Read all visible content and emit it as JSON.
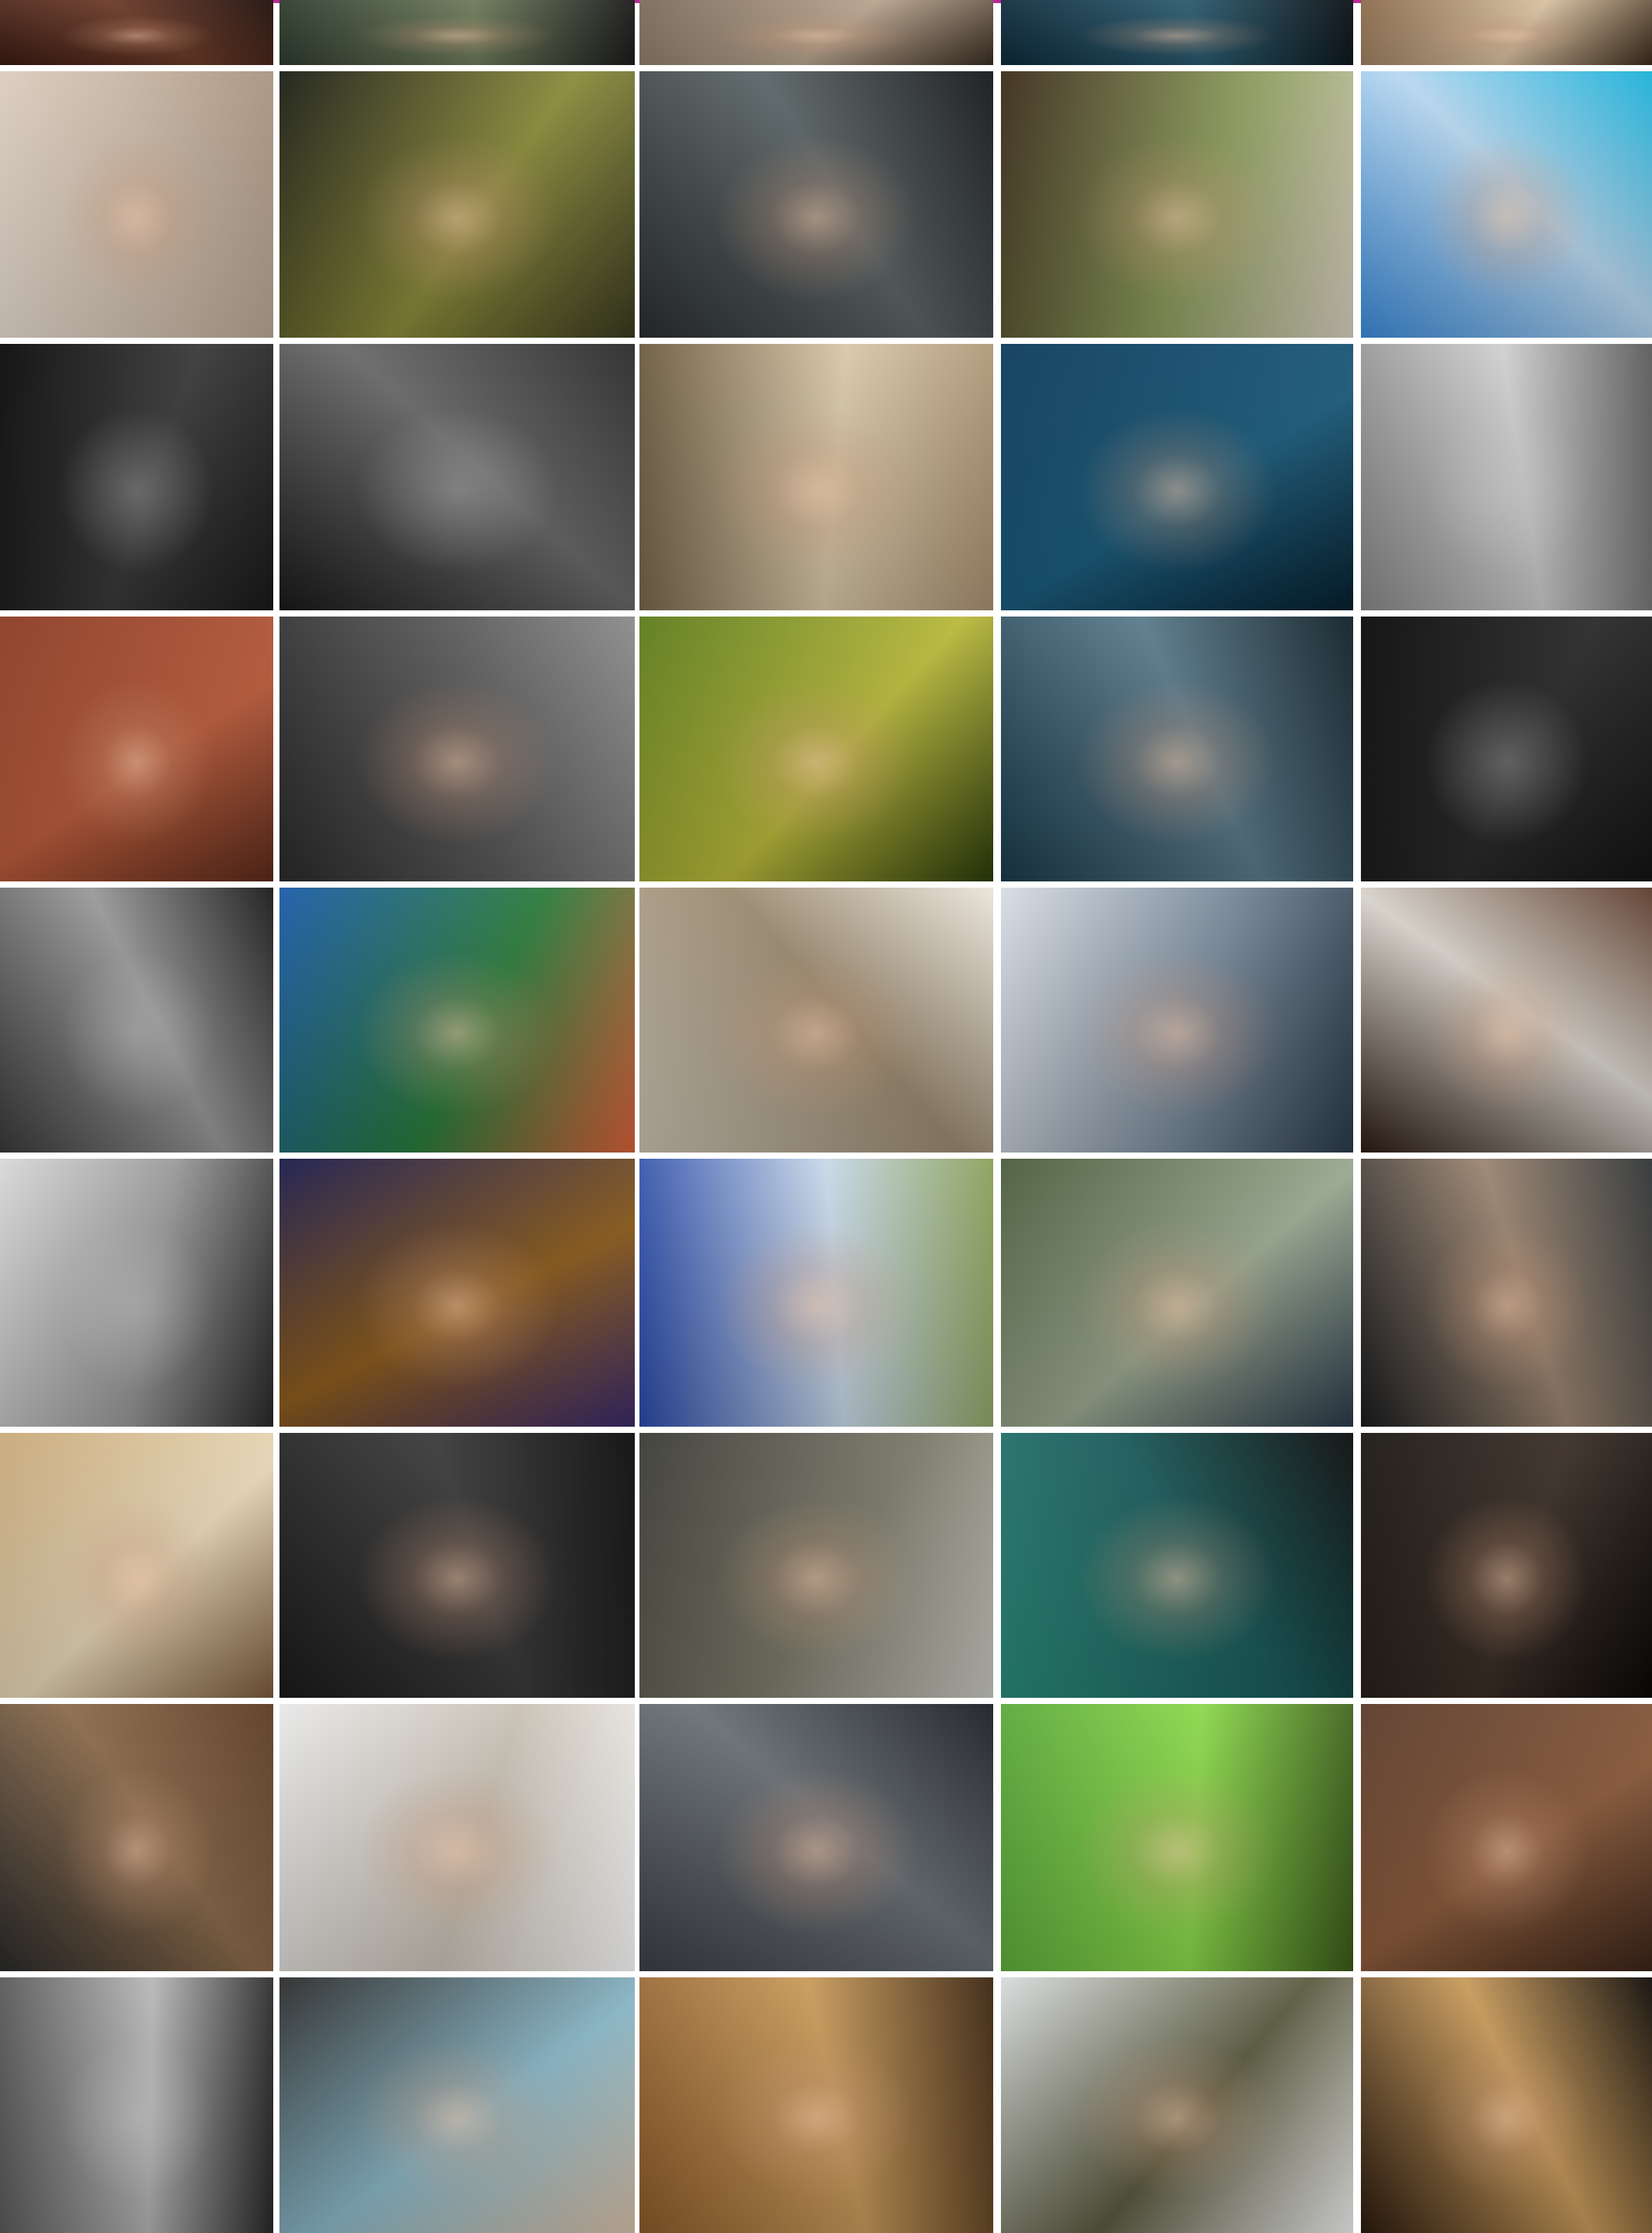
{
  "gallery": {
    "accent_color": "#c0269a",
    "columns": 5,
    "rows": 9,
    "photos": [
      {
        "row": 0,
        "col": 0,
        "palette": [
          "#3a1a12",
          "#6b3a28",
          "#1e0e0a"
        ],
        "bw": false
      },
      {
        "row": 0,
        "col": 1,
        "palette": [
          "#2e3b2e",
          "#6c7a5a",
          "#1a1a1a"
        ],
        "bw": false
      },
      {
        "row": 0,
        "col": 2,
        "palette": [
          "#7a6a5a",
          "#b8a48e",
          "#3a2e22"
        ],
        "bw": false
      },
      {
        "row": 0,
        "col": 3,
        "palette": [
          "#0e2a3a",
          "#2a5a6e",
          "#0a0f14"
        ],
        "bw": false
      },
      {
        "row": 0,
        "col": 4,
        "palette": [
          "#8a6a4a",
          "#d8c0a0",
          "#3a2a1a"
        ],
        "bw": false
      },
      {
        "row": 1,
        "col": 0,
        "palette": [
          "#e8dcd0",
          "#c9b8a6",
          "#a89480"
        ],
        "bw": false
      },
      {
        "row": 1,
        "col": 1,
        "palette": [
          "#1a1c14",
          "#8a8a3a",
          "#3a3a20"
        ],
        "bw": false
      },
      {
        "row": 1,
        "col": 2,
        "palette": [
          "#2a2e30",
          "#5a6466",
          "#141618"
        ],
        "bw": false
      },
      {
        "row": 1,
        "col": 3,
        "palette": [
          "#3a2a1a",
          "#8a9a5a",
          "#d8d0c0"
        ],
        "bw": false
      },
      {
        "row": 1,
        "col": 4,
        "palette": [
          "#3a8ad8",
          "#b8d8f0",
          "#1ab0d8"
        ],
        "bw": false
      },
      {
        "row": 2,
        "col": 0,
        "palette": [
          "#0a0a0a",
          "#3a3a3a",
          "#1a1a1a"
        ],
        "bw": true
      },
      {
        "row": 2,
        "col": 1,
        "palette": [
          "#1a1a1a",
          "#6a6a6a",
          "#2a2a2a"
        ],
        "bw": true
      },
      {
        "row": 2,
        "col": 2,
        "palette": [
          "#6a5a40",
          "#d8c8a8",
          "#a89070"
        ],
        "bw": false
      },
      {
        "row": 2,
        "col": 3,
        "palette": [
          "#0a3a5a",
          "#1a5a7a",
          "#06202e"
        ],
        "bw": false
      },
      {
        "row": 2,
        "col": 4,
        "palette": [
          "#8a8a8a",
          "#d0d0d0",
          "#5a5a5a"
        ],
        "bw": true
      },
      {
        "row": 3,
        "col": 0,
        "palette": [
          "#8a3a22",
          "#b85a3a",
          "#5a2a1a"
        ],
        "bw": false
      },
      {
        "row": 3,
        "col": 1,
        "palette": [
          "#2a2a2a",
          "#5a5a5a",
          "#8a8a8a"
        ],
        "bw": false
      },
      {
        "row": 3,
        "col": 2,
        "palette": [
          "#5a7a1a",
          "#b8b83a",
          "#2a3a0a"
        ],
        "bw": false
      },
      {
        "row": 3,
        "col": 3,
        "palette": [
          "#1a3a4a",
          "#5a7a8a",
          "#0e1e26"
        ],
        "bw": false
      },
      {
        "row": 3,
        "col": 4,
        "palette": [
          "#0a0a0a",
          "#2a2a2a",
          "#141414"
        ],
        "bw": true
      },
      {
        "row": 4,
        "col": 0,
        "palette": [
          "#3a3a3a",
          "#9a9a9a",
          "#1a1a1a"
        ],
        "bw": true
      },
      {
        "row": 4,
        "col": 1,
        "palette": [
          "#1a5aa8",
          "#2a7a3a",
          "#d8603a"
        ],
        "bw": false
      },
      {
        "row": 4,
        "col": 2,
        "palette": [
          "#c8c0b0",
          "#9a8a70",
          "#eae4da"
        ],
        "bw": false
      },
      {
        "row": 4,
        "col": 3,
        "palette": [
          "#d8dde4",
          "#7a8a9a",
          "#2a3a4a"
        ],
        "bw": false
      },
      {
        "row": 4,
        "col": 4,
        "palette": [
          "#2a1a12",
          "#d8d4cc",
          "#5a3a2a"
        ],
        "bw": false
      },
      {
        "row": 5,
        "col": 0,
        "palette": [
          "#d8d8d8",
          "#9a9a9a",
          "#2a2a2a"
        ],
        "bw": true
      },
      {
        "row": 5,
        "col": 1,
        "palette": [
          "#1a1a4a",
          "#8a5a1a",
          "#3a2a6a"
        ],
        "bw": false
      },
      {
        "row": 5,
        "col": 2,
        "palette": [
          "#2a4aa8",
          "#c8d8e8",
          "#8aa05a"
        ],
        "bw": false
      },
      {
        "row": 5,
        "col": 3,
        "palette": [
          "#4a5a3a",
          "#9aa890",
          "#2a3a4a"
        ],
        "bw": false
      },
      {
        "row": 5,
        "col": 4,
        "palette": [
          "#1a1c1e",
          "#9a8470",
          "#2e3234"
        ],
        "bw": false
      },
      {
        "row": 6,
        "col": 0,
        "palette": [
          "#c8a878",
          "#e8d8b8",
          "#7a5a3a"
        ],
        "bw": false
      },
      {
        "row": 6,
        "col": 1,
        "palette": [
          "#1a1a1a",
          "#3a3a3a",
          "#0a0a0a"
        ],
        "bw": false
      },
      {
        "row": 6,
        "col": 2,
        "palette": [
          "#3a3a34",
          "#7a7a6a",
          "#c8c8c0"
        ],
        "bw": false
      },
      {
        "row": 6,
        "col": 3,
        "palette": [
          "#2a8a7a",
          "#1a5a5a",
          "#0a0a0a"
        ],
        "bw": false
      },
      {
        "row": 6,
        "col": 4,
        "palette": [
          "#1a1612",
          "#3a2e26",
          "#0a0806"
        ],
        "bw": false
      },
      {
        "row": 7,
        "col": 0,
        "palette": [
          "#2a2a2a",
          "#8a6a4a",
          "#5a3a22"
        ],
        "bw": false
      },
      {
        "row": 7,
        "col": 1,
        "palette": [
          "#e8e8e8",
          "#c8c0b4",
          "#fafafa"
        ],
        "bw": false
      },
      {
        "row": 7,
        "col": 2,
        "palette": [
          "#3a3e44",
          "#6a7076",
          "#1a1e22"
        ],
        "bw": false
      },
      {
        "row": 7,
        "col": 3,
        "palette": [
          "#5aa83a",
          "#8ad84a",
          "#3a5a1a"
        ],
        "bw": false
      },
      {
        "row": 7,
        "col": 4,
        "palette": [
          "#5a3a2a",
          "#8a5a3a",
          "#3a2418"
        ],
        "bw": false
      },
      {
        "row": 8,
        "col": 0,
        "palette": [
          "#5a5a5a",
          "#b8b8b8",
          "#2a2a2a"
        ],
        "bw": true
      },
      {
        "row": 8,
        "col": 1,
        "palette": [
          "#2a2a2a",
          "#8ab8c8",
          "#d8c0a8"
        ],
        "bw": false
      },
      {
        "row": 8,
        "col": 2,
        "palette": [
          "#8a5a2a",
          "#c89a5a",
          "#3a2410"
        ],
        "bw": false
      },
      {
        "row": 8,
        "col": 3,
        "palette": [
          "#d8dcdc",
          "#5a5a40",
          "#f0f0f0"
        ],
        "bw": false
      },
      {
        "row": 8,
        "col": 4,
        "palette": [
          "#2a1a0e",
          "#c89a5a",
          "#0e0a06"
        ],
        "bw": false
      }
    ]
  }
}
